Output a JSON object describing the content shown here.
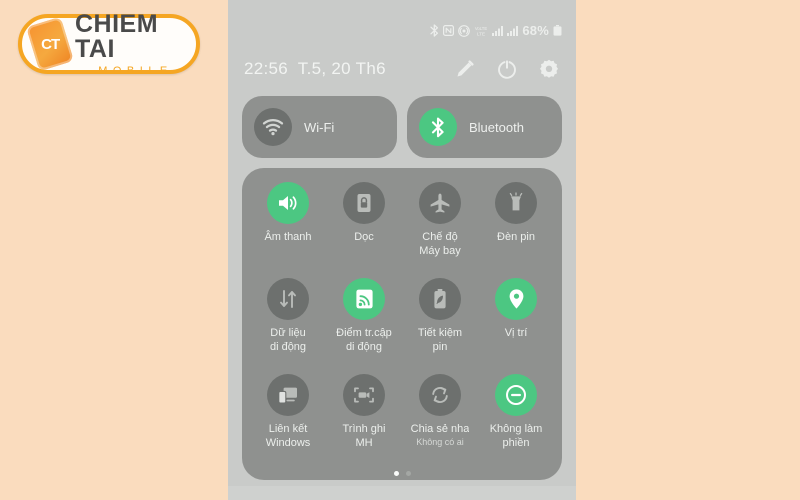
{
  "brand": {
    "phone_mark": "CT",
    "title": "CHIEM TAI",
    "subtitle": "MOBILE",
    "accent_color": "#f5a623"
  },
  "colors": {
    "page_background": "#fadcbe",
    "phone_background": "#c9cbc9",
    "panel": "#8f918f",
    "tile_off": "#6d706e",
    "tile_on": "#4cc782",
    "text": "#ecefec"
  },
  "status_bar": {
    "icons": [
      {
        "name": "bluetooth-status-icon",
        "label": "Bluetooth"
      },
      {
        "name": "nfc-status-icon",
        "label": "NFC"
      },
      {
        "name": "hotspot-status-icon",
        "label": "Hotspot"
      },
      {
        "name": "lte-status-icon",
        "label": "LTE"
      },
      {
        "name": "signal-bars-1-icon",
        "label": "Signal 1"
      },
      {
        "name": "signal-bars-2-icon",
        "label": "Signal 2"
      }
    ],
    "battery_percent": "68%"
  },
  "header": {
    "clock": "22:56  T.5, 20 Th6",
    "actions": [
      {
        "name": "edit-pencil-button",
        "label": "Chỉnh sửa"
      },
      {
        "name": "power-button",
        "label": "Nguồn"
      },
      {
        "name": "settings-gear-button",
        "label": "Cài đặt"
      }
    ]
  },
  "big_tiles": [
    {
      "icon": "wifi-icon",
      "label": "Wi-Fi",
      "state": "off"
    },
    {
      "icon": "bluetooth-icon",
      "label": "Bluetooth",
      "state": "on"
    }
  ],
  "quick_settings": {
    "rows": [
      [
        {
          "icon": "sound-volume-icon",
          "label": "Âm thanh",
          "state": "on"
        },
        {
          "icon": "rotation-lock-icon",
          "label": "Dọc",
          "state": "off"
        },
        {
          "icon": "airplane-mode-icon",
          "label": "Chế độ\nMáy bay",
          "state": "off"
        },
        {
          "icon": "flashlight-icon",
          "label": "Đèn pin",
          "state": "off"
        }
      ],
      [
        {
          "icon": "mobile-data-icon",
          "label": "Dữ liệu\ndi động",
          "state": "off"
        },
        {
          "icon": "hotspot-icon",
          "label": "Điểm tr.cập\ndi động",
          "state": "on"
        },
        {
          "icon": "battery-saver-icon",
          "label": "Tiết kiệm\npin",
          "state": "off"
        },
        {
          "icon": "location-pin-icon",
          "label": "Vị trí",
          "state": "on"
        }
      ],
      [
        {
          "icon": "link-to-windows-icon",
          "label": "Liên kết\nWindows",
          "state": "off"
        },
        {
          "icon": "screen-recorder-icon",
          "label": "Trình ghi\nMH",
          "state": "off"
        },
        {
          "icon": "quick-share-icon",
          "label": "Chia sẻ nha",
          "sublabel": "Không có ai",
          "state": "off",
          "clipped": true
        },
        {
          "icon": "do-not-disturb-icon",
          "label": "Không làm\nphiền",
          "state": "on"
        }
      ]
    ]
  },
  "page_dots": {
    "count": 2,
    "active_index": 0
  }
}
